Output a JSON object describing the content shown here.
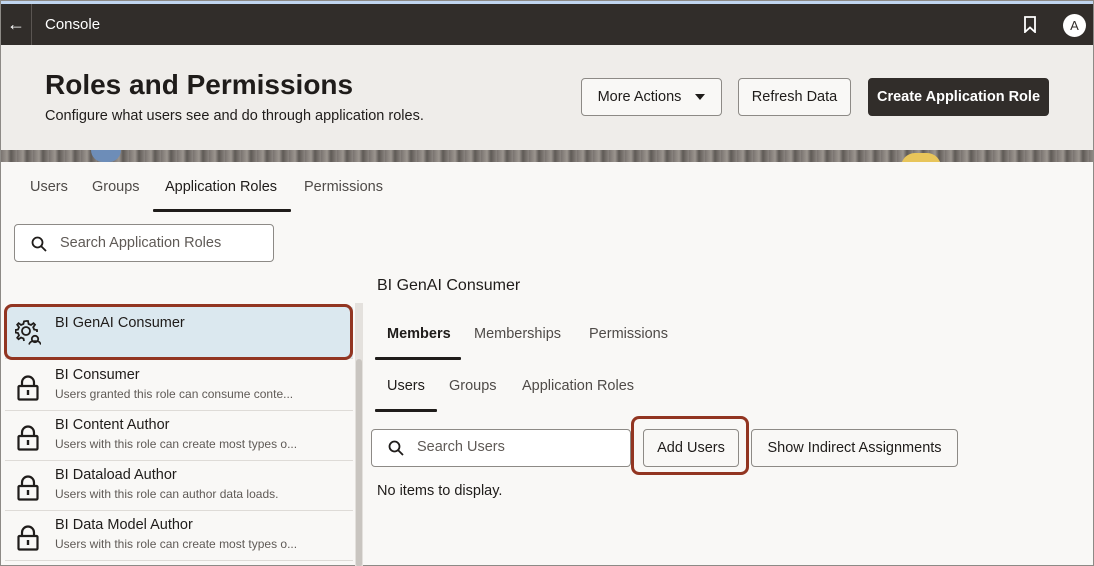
{
  "topbar": {
    "title": "Console",
    "avatar_initial": "A"
  },
  "header": {
    "title": "Roles and Permissions",
    "subtitle": "Configure what users see and do through application roles.",
    "more_actions_label": "More Actions",
    "refresh_label": "Refresh Data",
    "create_label": "Create Application Role"
  },
  "main_tabs": [
    {
      "label": "Users"
    },
    {
      "label": "Groups"
    },
    {
      "label": "Application Roles"
    },
    {
      "label": "Permissions"
    }
  ],
  "roles_search": {
    "placeholder": "Search Application Roles"
  },
  "roles": [
    {
      "name": "BI GenAI Consumer",
      "desc": ""
    },
    {
      "name": "BI Consumer",
      "desc": "Users granted this role can consume conte..."
    },
    {
      "name": "BI Content Author",
      "desc": "Users with this role can create most types o..."
    },
    {
      "name": "BI Dataload Author",
      "desc": "Users with this role can author data loads."
    },
    {
      "name": "BI Data Model Author",
      "desc": "Users with this role can create most types o..."
    }
  ],
  "detail": {
    "title": "BI GenAI Consumer",
    "tabs": [
      {
        "label": "Members"
      },
      {
        "label": "Memberships"
      },
      {
        "label": "Permissions"
      }
    ],
    "member_tabs": [
      {
        "label": "Users"
      },
      {
        "label": "Groups"
      },
      {
        "label": "Application Roles"
      }
    ],
    "search_placeholder": "Search Users",
    "add_users_label": "Add Users",
    "show_indirect_label": "Show Indirect Assignments",
    "empty_text": "No items to display."
  },
  "icons": {
    "back": "arrow-left-icon",
    "bookmark": "bookmark-icon",
    "search": "search-icon",
    "role_selected": "gear-person-icon",
    "role": "lock-icon"
  },
  "colors": {
    "topbar": "#312d2a",
    "primary_button": "#312d2a",
    "selected_row": "#dbe8ef",
    "highlight_outline": "#923521"
  }
}
